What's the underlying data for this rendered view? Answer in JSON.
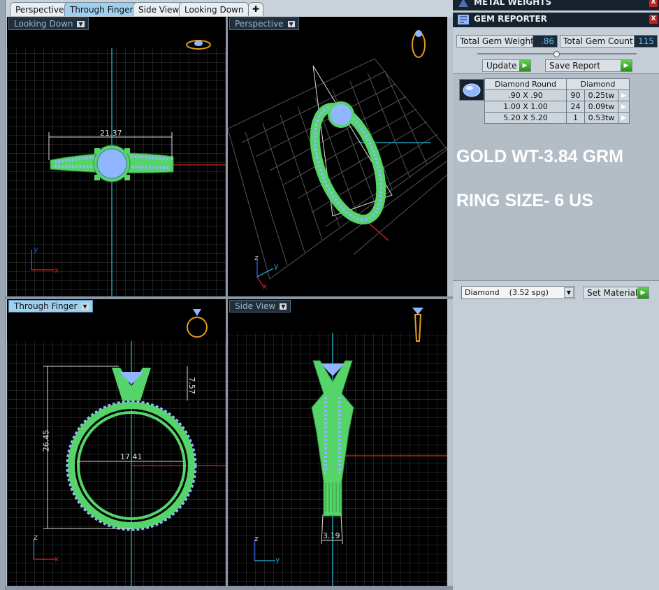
{
  "tabs": [
    {
      "label": "Perspective",
      "active": false
    },
    {
      "label": "Through Finger",
      "active": true
    },
    {
      "label": "Side View",
      "active": false
    },
    {
      "label": "Looking Down",
      "active": false
    }
  ],
  "tab_add_icon": "plus-icon",
  "viewports": {
    "top_left": {
      "label": "Looking Down",
      "dimension": "21.37",
      "axis_a": "y",
      "axis_b": "x"
    },
    "top_right": {
      "label": "Perspective",
      "axis_a": "z",
      "axis_b": "y",
      "axis_c": "x"
    },
    "bottom_left": {
      "label": "Through Finger",
      "dim_height": "26.45",
      "dim_width": "17.41",
      "dim_head": "7.57",
      "axis_a": "z",
      "axis_b": "x"
    },
    "bottom_right": {
      "label": "Side View",
      "dim_shank": "3.19",
      "axis_a": "z",
      "axis_b": "y"
    }
  },
  "panel": {
    "metal_weights_title": "METAL WEIGHTS",
    "gem_reporter_title": "GEM REPORTER",
    "close_glyph": "X",
    "total_gem_weight_label": "Total Gem Weight",
    "total_gem_weight_value": ".86",
    "total_gem_count_label": "Total Gem Count",
    "total_gem_count_value": "115",
    "update_label": "Update",
    "save_report_label": "Save Report",
    "arrow_glyph": "▶",
    "table_headers": [
      "Diamond Round",
      "Diamond"
    ],
    "table_rows": [
      {
        "size": ".90 X .90",
        "count": "90",
        "weight": "0.25tw"
      },
      {
        "size": "1.00 X 1.00",
        "count": "24",
        "weight": "0.09tw"
      },
      {
        "size": "5.20 X 5.20",
        "count": "1",
        "weight": "0.53tw"
      }
    ],
    "gold_weight_text": "GOLD WT-3.84 GRM",
    "ring_size_text": "RING SIZE- 6 US",
    "material_select_value": "Diamond    (3.52 spg)",
    "set_material_label": "Set Material"
  },
  "colors": {
    "ring_metal": "#55d46a",
    "gems": "#8fb6ff",
    "grid": "#3a3a3a",
    "x_axis": "#c41a1a",
    "y_axis": "#1aa0b8",
    "panel_header": "#16232f",
    "active_tab": "#9fd0ee"
  }
}
